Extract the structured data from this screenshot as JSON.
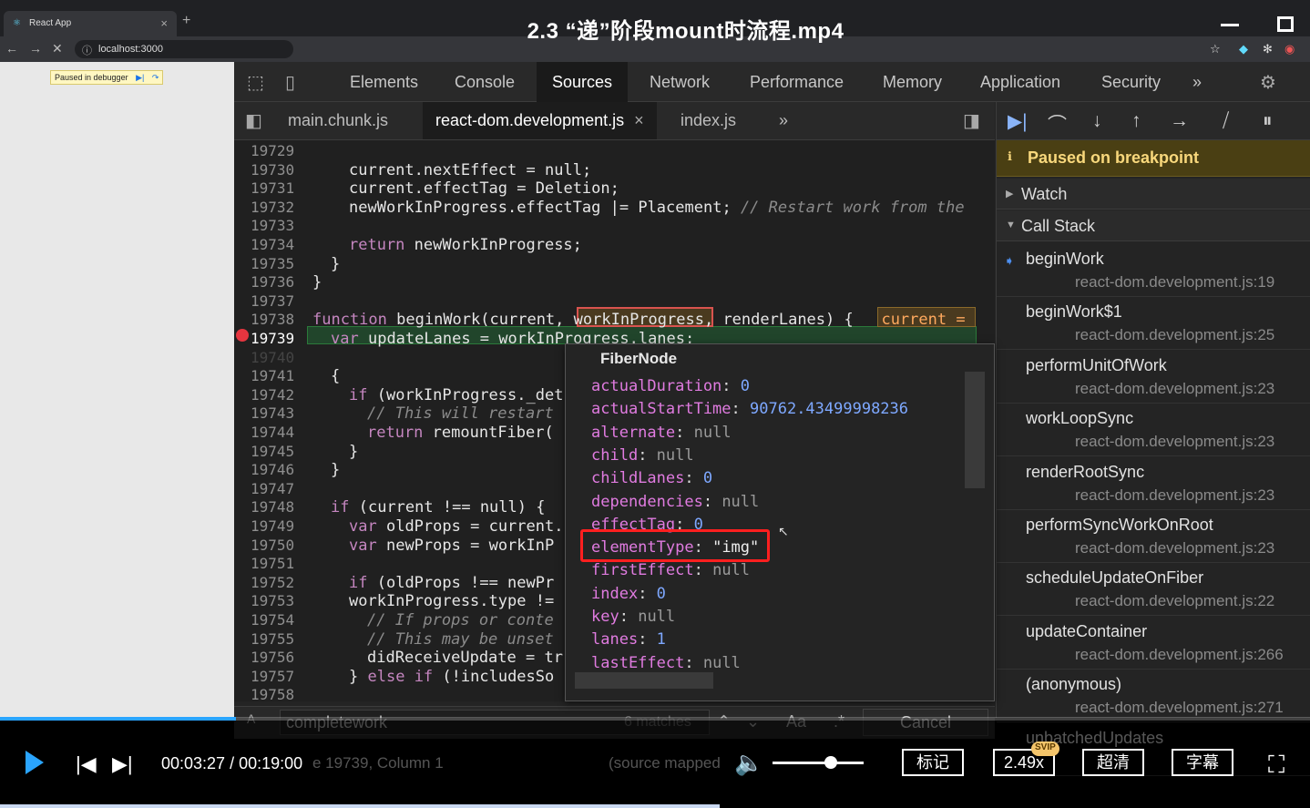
{
  "video": {
    "title": "2.3 “递”阶段mount时流程.mp4",
    "time_current": "00:03:27",
    "time_total": "00:19:00",
    "progress": 0.18,
    "volume": 0.6,
    "buttons": {
      "mark": "标记",
      "speed": "2.49x",
      "svip": "SVIP",
      "quality": "超清",
      "subtitle": "字幕"
    }
  },
  "browser": {
    "tab_title": "React App",
    "tab_close": "×",
    "new_tab": "+",
    "address": "localhost:3000"
  },
  "page": {
    "paused_badge": "Paused in debugger"
  },
  "devtools": {
    "tabs": [
      "Elements",
      "Console",
      "Sources",
      "Network",
      "Performance",
      "Memory",
      "Application",
      "Security"
    ],
    "active_tab": "Sources",
    "more": "»",
    "source_tabs": [
      "main.chunk.js",
      "react-dom.development.js",
      "index.js"
    ],
    "source_tab_close": "×",
    "editor": {
      "lines": [
        {
          "n": "19729",
          "code": ""
        },
        {
          "n": "19730",
          "code": "current.nextEffect = null;"
        },
        {
          "n": "19731",
          "code": "current.effectTag = Deletion;"
        },
        {
          "n": "19732",
          "code": "newWorkInProgress.effectTag |= Placement;",
          "comment": "// Restart work from the"
        },
        {
          "n": "19733",
          "code": ""
        },
        {
          "n": "19734",
          "code": "return newWorkInProgress;"
        },
        {
          "n": "19735",
          "code": "}"
        },
        {
          "n": "19736",
          "code": "}"
        },
        {
          "n": "19737",
          "code": ""
        },
        {
          "n": "19738",
          "code": "function beginWork(current, workInProgress, renderLanes) {",
          "inline": "current ="
        },
        {
          "n": "19739",
          "code": "var updateLanes = workInProgress.lanes;"
        },
        {
          "n": "19740",
          "code": ""
        },
        {
          "n": "19741",
          "code": "{"
        },
        {
          "n": "19742",
          "code": "if (workInProgress._det"
        },
        {
          "n": "19743",
          "code": "// This will restart"
        },
        {
          "n": "19744",
          "code": "return remountFiber("
        },
        {
          "n": "19745",
          "code": "}"
        },
        {
          "n": "19746",
          "code": "}"
        },
        {
          "n": "19747",
          "code": ""
        },
        {
          "n": "19748",
          "code": "if (current !== null) {"
        },
        {
          "n": "19749",
          "code": "var oldProps = current."
        },
        {
          "n": "19750",
          "code": "var newProps = workInP"
        },
        {
          "n": "19751",
          "code": ""
        },
        {
          "n": "19752",
          "code": "if (oldProps !== newPr"
        },
        {
          "n": "19753",
          "code": "workInProgress.type !="
        },
        {
          "n": "19754",
          "code": "// If props or conte"
        },
        {
          "n": "19755",
          "code": "// This may be unset"
        },
        {
          "n": "19756",
          "code": "didReceiveUpdate = tr"
        },
        {
          "n": "19757",
          "code": "} else if (!includesSo"
        },
        {
          "n": "19758",
          "code": ""
        }
      ]
    },
    "popover": {
      "title": "FiberNode",
      "props": [
        {
          "k": "actualDuration",
          "v": "0",
          "t": "num"
        },
        {
          "k": "actualStartTime",
          "v": "90762.43499998236",
          "t": "num"
        },
        {
          "k": "alternate",
          "v": "null",
          "t": "null"
        },
        {
          "k": "child",
          "v": "null",
          "t": "null"
        },
        {
          "k": "childLanes",
          "v": "0",
          "t": "num"
        },
        {
          "k": "dependencies",
          "v": "null",
          "t": "null"
        },
        {
          "k": "effectTag",
          "v": "0",
          "t": "num"
        },
        {
          "k": "elementType",
          "v": "\"img\"",
          "t": "str"
        },
        {
          "k": "firstEffect",
          "v": "null",
          "t": "null"
        },
        {
          "k": "index",
          "v": "0",
          "t": "num"
        },
        {
          "k": "key",
          "v": "null",
          "t": "null"
        },
        {
          "k": "lanes",
          "v": "1",
          "t": "num"
        },
        {
          "k": "lastEffect",
          "v": "null",
          "t": "null"
        }
      ]
    },
    "debugger": {
      "paused_text": "Paused on breakpoint",
      "watch_label": "Watch",
      "callstack_label": "Call Stack",
      "frames": [
        {
          "name": "beginWork",
          "loc": "react-dom.development.js:19"
        },
        {
          "name": "beginWork$1",
          "loc": "react-dom.development.js:25"
        },
        {
          "name": "performUnitOfWork",
          "loc": "react-dom.development.js:23"
        },
        {
          "name": "workLoopSync",
          "loc": "react-dom.development.js:23"
        },
        {
          "name": "renderRootSync",
          "loc": "react-dom.development.js:23"
        },
        {
          "name": "performSyncWorkOnRoot",
          "loc": "react-dom.development.js:23"
        },
        {
          "name": "scheduleUpdateOnFiber",
          "loc": "react-dom.development.js:22"
        },
        {
          "name": "updateContainer",
          "loc": "react-dom.development.js:266"
        },
        {
          "name": "(anonymous)",
          "loc": "react-dom.development.js:271"
        },
        {
          "name": "unbatchedUpdates",
          "loc": ""
        }
      ]
    },
    "search": {
      "query": "completework",
      "matches": "6 matches",
      "case_label": "Aa",
      "regex_label": ".*",
      "cancel": "Cancel"
    },
    "status": {
      "position": "e 19739, Column 1",
      "source_mapped": "(source mapped"
    }
  }
}
